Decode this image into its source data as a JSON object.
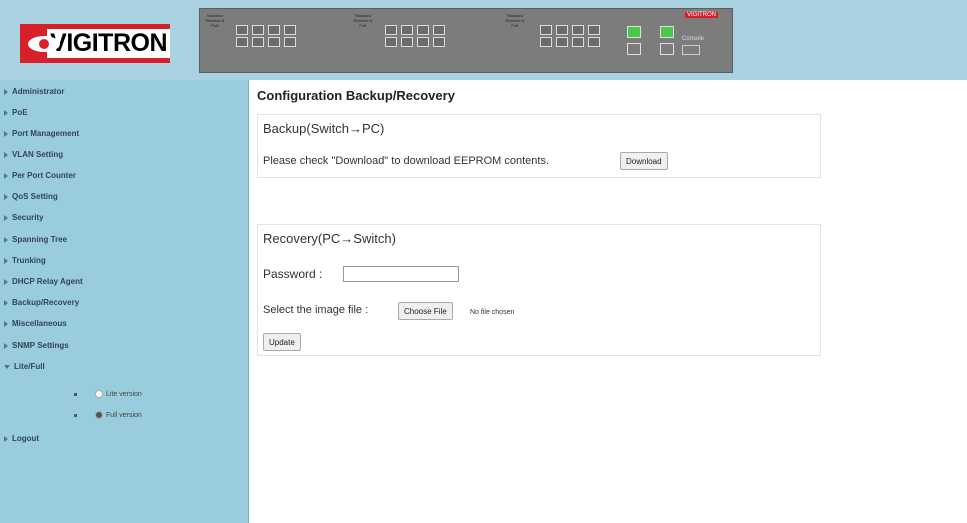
{
  "brand": {
    "logo_text": "VIGITRON"
  },
  "panel": {
    "group_labels": [
      "Standard Ethernet & PoE",
      "Standard Ethernet & PoE",
      "Standard Ethernet & PoE"
    ],
    "brand_tag": "VIGITRON",
    "console_label": "Console"
  },
  "nav": {
    "items": [
      "Administrator",
      "PoE",
      "Port Management",
      "VLAN Setting",
      "Per Port Counter",
      "QoS Setting",
      "Security",
      "Spanning Tree",
      "Trunking",
      "DHCP Relay Agent",
      "Backup/Recovery",
      "Miscellaneous",
      "SNMP Settings",
      "Lite/Full"
    ],
    "sub_items": [
      "Lite version",
      "Full version"
    ],
    "logout": "Logout"
  },
  "main": {
    "page_title": "Configuration Backup/Recovery",
    "backup": {
      "title": "Backup(Switch→PC)",
      "instruction": "Please check \"Download\" to download EEPROM contents.",
      "download_label": "Download"
    },
    "recovery": {
      "title": "Recovery(PC→Switch)",
      "password_label": "Password :",
      "password_value": "",
      "select_label": "Select the image file :",
      "choose_label": "Choose File",
      "no_file_text": "No file chosen",
      "update_label": "Update"
    }
  },
  "colors": {
    "header_bg": "#aad3e1",
    "nav_bg": "#99ccdc",
    "logo_red": "#d8202b",
    "sfp_green": "#49c94c"
  }
}
